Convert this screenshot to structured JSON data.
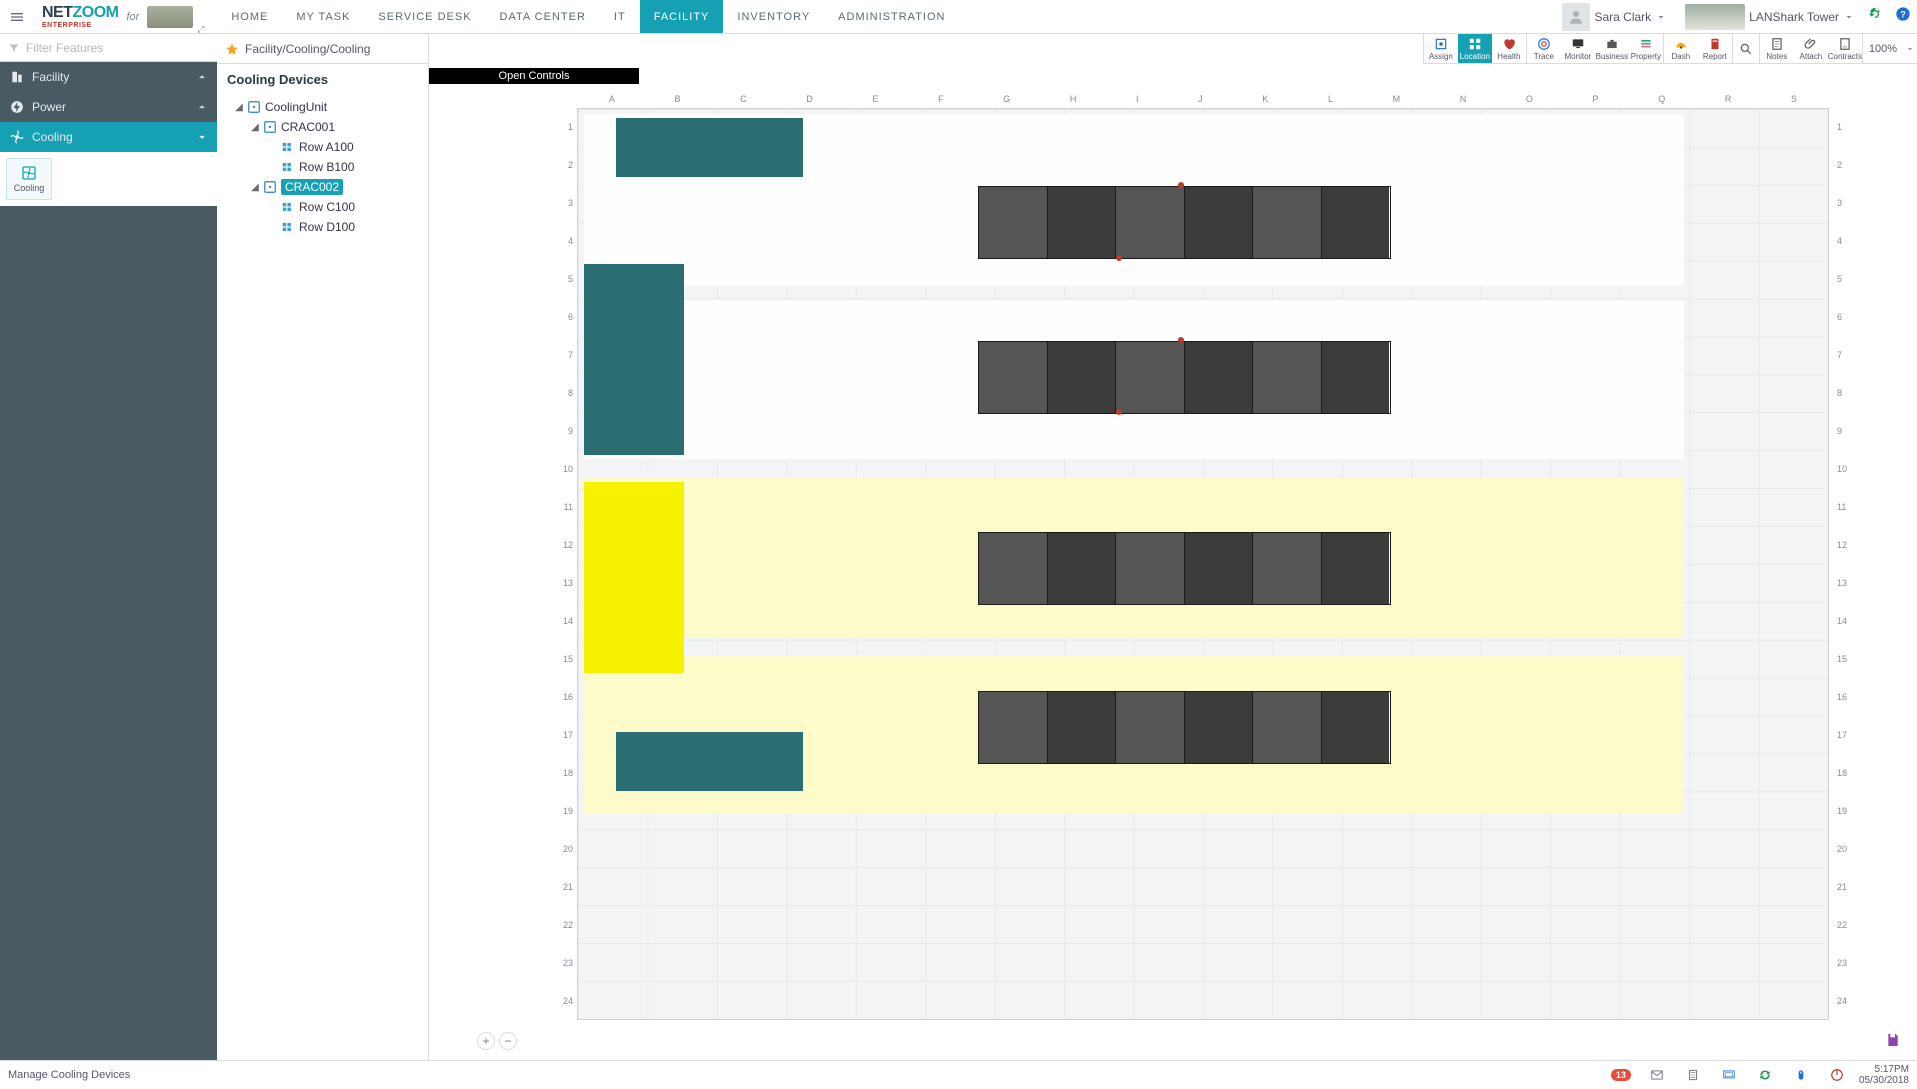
{
  "app": {
    "brand_a": "NET",
    "brand_b": "ZOOM",
    "brand_sub": "ENTERPRISE",
    "for": "for"
  },
  "menu": [
    {
      "label": "HOME",
      "active": false
    },
    {
      "label": "MY TASK",
      "active": false
    },
    {
      "label": "SERVICE DESK",
      "active": false
    },
    {
      "label": "DATA CENTER",
      "active": false
    },
    {
      "label": "IT",
      "active": false
    },
    {
      "label": "FACILITY",
      "active": true
    },
    {
      "label": "INVENTORY",
      "active": false
    },
    {
      "label": "ADMINISTRATION",
      "active": false
    }
  ],
  "user": {
    "name": "Sara Clark"
  },
  "location_picker": "LANShark Tower",
  "filter_placeholder": "Filter Features",
  "rail": {
    "facility": "Facility",
    "power": "Power",
    "cooling": "Cooling",
    "sub_cooling": "Cooling"
  },
  "tree": {
    "breadcrumb": "Facility/Cooling/Cooling",
    "title": "Cooling Devices",
    "root": "CoolingUnit",
    "crac001": "CRAC001",
    "rowA": "Row A100",
    "rowB": "Row B100",
    "crac002": "CRAC002",
    "rowC": "Row C100",
    "rowD": "Row D100"
  },
  "open_controls": "Open Controls",
  "toolbar": {
    "assign": "Assign",
    "location": "Location",
    "health": "Health",
    "trace": "Trace",
    "monitor": "Monitor",
    "business": "Business",
    "property": "Property",
    "dash": "Dash",
    "report": "Report",
    "notes": "Notes",
    "attach": "Attach",
    "contracts": "Contracts",
    "zoom": "100%"
  },
  "grid": {
    "cols": [
      "A",
      "B",
      "C",
      "D",
      "E",
      "F",
      "G",
      "H",
      "I",
      "J",
      "K",
      "L",
      "M",
      "N",
      "O",
      "P",
      "Q",
      "R",
      "S"
    ],
    "rows": [
      "1",
      "2",
      "3",
      "4",
      "5",
      "6",
      "7",
      "8",
      "9",
      "10",
      "11",
      "12",
      "13",
      "14",
      "15",
      "16",
      "17",
      "18",
      "19",
      "20",
      "21",
      "22",
      "23",
      "24"
    ]
  },
  "footer": {
    "status": "Manage Cooling Devices",
    "badge": "13",
    "time": "5:17PM",
    "date": "05/30/2018"
  }
}
